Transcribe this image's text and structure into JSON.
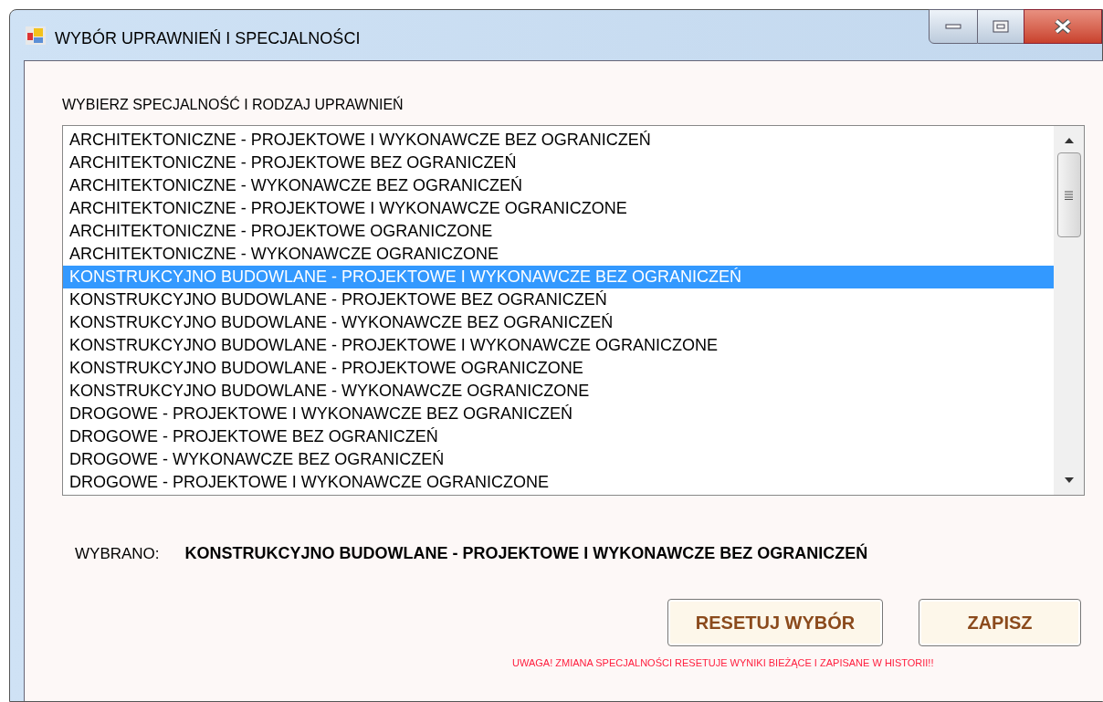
{
  "window": {
    "title": "WYBÓR UPRAWNIEŃ I SPECJALNOŚCI"
  },
  "prompt": "WYBIERZ SPECJALNOŚĆ I RODZAJ UPRAWNIEŃ",
  "list": {
    "items": [
      {
        "label": "ARCHITEKTONICZNE - PROJEKTOWE I WYKONAWCZE BEZ OGRANICZEŃ",
        "selected": false
      },
      {
        "label": "ARCHITEKTONICZNE - PROJEKTOWE BEZ OGRANICZEŃ",
        "selected": false
      },
      {
        "label": "ARCHITEKTONICZNE - WYKONAWCZE BEZ OGRANICZEŃ",
        "selected": false
      },
      {
        "label": "ARCHITEKTONICZNE - PROJEKTOWE I WYKONAWCZE OGRANICZONE",
        "selected": false
      },
      {
        "label": "ARCHITEKTONICZNE - PROJEKTOWE OGRANICZONE",
        "selected": false
      },
      {
        "label": "ARCHITEKTONICZNE - WYKONAWCZE OGRANICZONE",
        "selected": false
      },
      {
        "label": "KONSTRUKCYJNO BUDOWLANE - PROJEKTOWE I WYKONAWCZE BEZ OGRANICZEŃ",
        "selected": true
      },
      {
        "label": "KONSTRUKCYJNO BUDOWLANE - PROJEKTOWE BEZ OGRANICZEŃ",
        "selected": false
      },
      {
        "label": "KONSTRUKCYJNO BUDOWLANE - WYKONAWCZE BEZ OGRANICZEŃ",
        "selected": false
      },
      {
        "label": "KONSTRUKCYJNO BUDOWLANE - PROJEKTOWE I WYKONAWCZE OGRANICZONE",
        "selected": false
      },
      {
        "label": "KONSTRUKCYJNO BUDOWLANE - PROJEKTOWE OGRANICZONE",
        "selected": false
      },
      {
        "label": "KONSTRUKCYJNO BUDOWLANE - WYKONAWCZE OGRANICZONE",
        "selected": false
      },
      {
        "label": "DROGOWE - PROJEKTOWE I WYKONAWCZE BEZ OGRANICZEŃ",
        "selected": false
      },
      {
        "label": "DROGOWE - PROJEKTOWE BEZ OGRANICZEŃ",
        "selected": false
      },
      {
        "label": "DROGOWE - WYKONAWCZE BEZ OGRANICZEŃ",
        "selected": false
      },
      {
        "label": "DROGOWE - PROJEKTOWE I WYKONAWCZE OGRANICZONE",
        "selected": false
      }
    ]
  },
  "selection": {
    "label": "WYBRANO:",
    "value": "KONSTRUKCYJNO BUDOWLANE - PROJEKTOWE I WYKONAWCZE BEZ OGRANICZEŃ"
  },
  "buttons": [
    "RESETUJ WYBÓR",
    "ZAPISZ"
  ],
  "warning": "UWAGA! ZMIANA SPECJALNOŚCI RESETUJE WYNIKI BIEŻĄCE I ZAPISANE W HISTORII!!"
}
